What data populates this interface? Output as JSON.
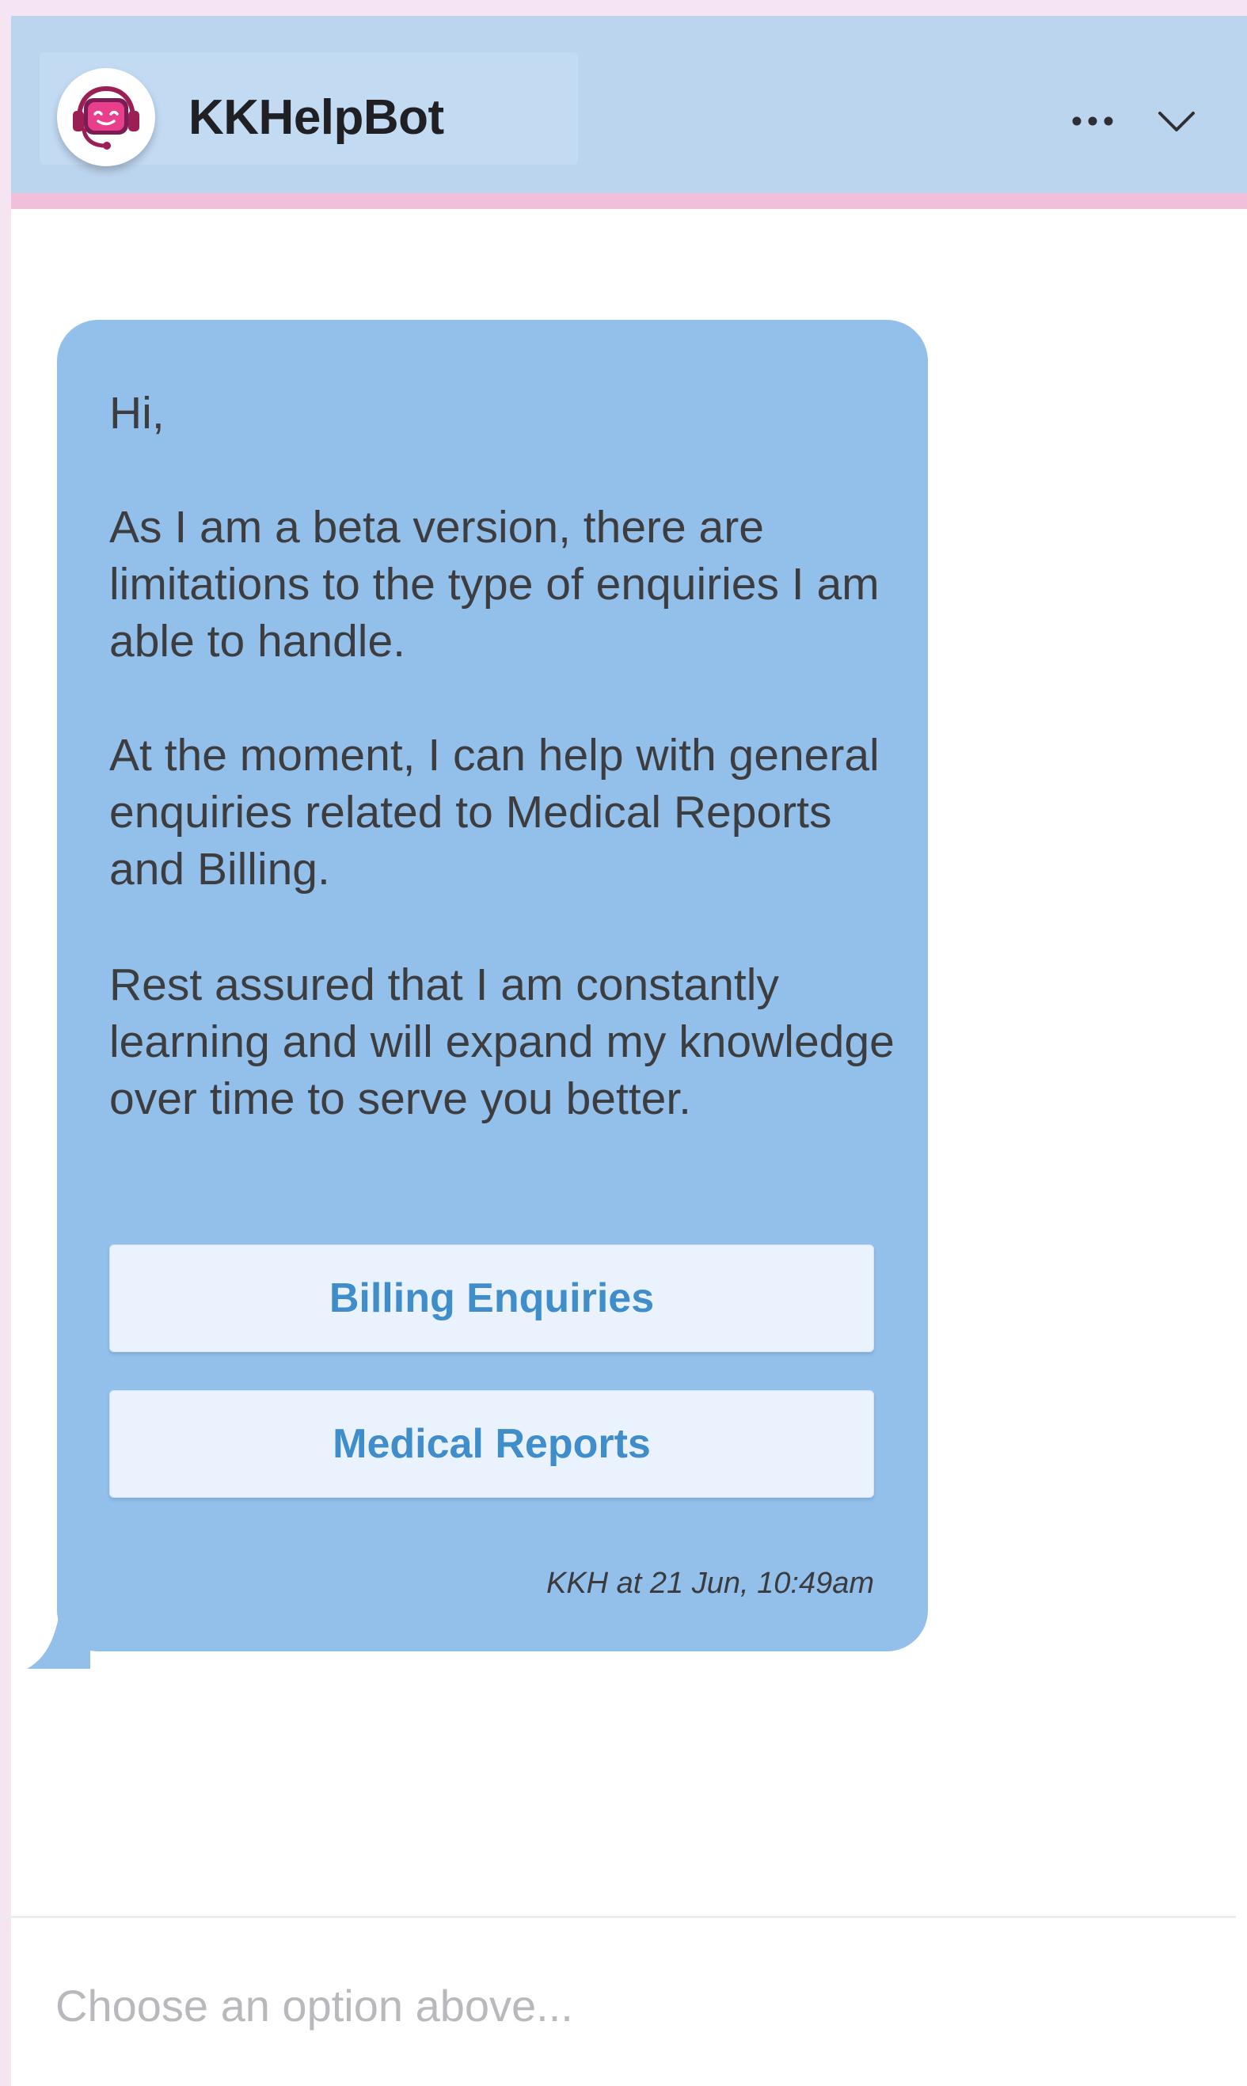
{
  "header": {
    "title": "KKHelpBot",
    "bot_icon": "robot-headset-icon",
    "more_icon": "more-horizontal-icon",
    "collapse_icon": "chevron-down-icon"
  },
  "message": {
    "greeting": "Hi,",
    "paragraph_1": "As I am a beta version, there are limitations to the type of enquiries I am able to handle.",
    "paragraph_2": "At the moment, I can help with general enquiries related to Medical Reports and Billing.",
    "paragraph_3": "Rest assured that I am constantly learning and will expand my knowledge over time to serve you better.",
    "options": [
      {
        "label": "Billing Enquiries"
      },
      {
        "label": "Medical Reports"
      }
    ],
    "timestamp": "KKH at 21 Jun, 10:49am"
  },
  "composer": {
    "placeholder": "Choose an option above...",
    "value": ""
  },
  "colors": {
    "header_bg": "#bcd5ee",
    "header_accent": "#f2bfda",
    "bubble_bg": "#93c0ea",
    "option_text": "#3f8dca",
    "page_bg": "#f5e4f1"
  }
}
